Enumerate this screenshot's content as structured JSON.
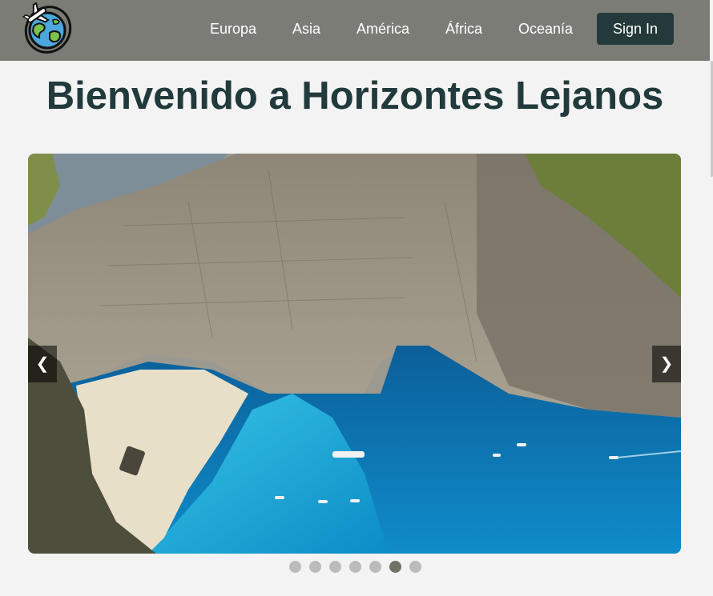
{
  "header": {
    "nav": [
      {
        "label": "Europa"
      },
      {
        "label": "Asia"
      },
      {
        "label": "América"
      },
      {
        "label": "África"
      },
      {
        "label": "Oceanía"
      }
    ],
    "signin_label": "Sign In"
  },
  "main": {
    "title": "Bienvenido a Horizontes Lejanos"
  },
  "carousel": {
    "prev_label": "❮",
    "next_label": "❯",
    "slide_count": 7,
    "active_index": 5
  },
  "colors": {
    "header_bg": "#7c7c76",
    "title": "#213a3b",
    "signin_bg": "#243a3a",
    "page_bg": "#f3f3f3"
  }
}
